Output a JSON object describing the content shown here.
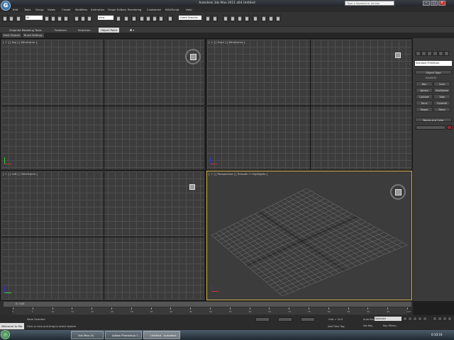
{
  "app": {
    "title": "Autodesk 3ds Max  2011 x64     Untitled",
    "logo_letter": "G",
    "search_placeholder": "Type a keyword or phrase"
  },
  "menu": [
    "Edit",
    "Tools",
    "Group",
    "Views",
    "Create",
    "Modifiers",
    "Animation",
    "Graph Editors",
    "Rendering",
    "Customize",
    "MAXScript",
    "Help"
  ],
  "toolbar": {
    "selection_filter": "All",
    "reference_coord": "View",
    "named_selection": "Create Selection Se"
  },
  "ribbon": {
    "tabs": [
      "Graphite Modeling Tools",
      "Freeform",
      "Selection",
      "Object Paint"
    ],
    "active_tab": 3,
    "subtabs": [
      "Paint Objects",
      "Brush Settings"
    ]
  },
  "viewports": {
    "top": "[ + ] [ Top ] [ Wireframe ]",
    "front": "[ + ] [ Front ] [ Wireframe ]",
    "left": "[ + ] [ Left ] [ Wireframe ]",
    "perspective": "[ + ] [ Perspective ] [ Smooth + Highlights ]"
  },
  "command_panel": {
    "dropdown": "Standard Primitives",
    "object_type_title": "Object Type",
    "autogrid": "AutoGrid",
    "objects": [
      "Box",
      "Cone",
      "Sphere",
      "GeoSphere",
      "Cylinder",
      "Tube",
      "Torus",
      "Pyramid",
      "Teapot",
      "Plane"
    ],
    "name_color_title": "Name and Color",
    "color": "#a0202a"
  },
  "timeline": {
    "slider": "0 / 100",
    "ticks": [
      "0",
      "5",
      "10",
      "15",
      "20",
      "25",
      "30",
      "35",
      "40",
      "45",
      "50",
      "55",
      "60",
      "65",
      "70",
      "75",
      "80",
      "85",
      "90",
      "95",
      "100"
    ]
  },
  "status": {
    "maxscript": "Welcome to Ma",
    "none_selected": "None Selected",
    "prompt": "Click or click-and-drag to select objects",
    "grid": "Grid = 10.0",
    "add_time_tag": "Add Time Tag",
    "auto_key": "Auto Key",
    "set_key": "Set Key",
    "selected": "Selected",
    "key_filters": "Key Filters..."
  },
  "taskbar": {
    "items": [
      "3ds Max (5)",
      "Adobe Photoshop C...",
      "Untitled - Autodesk..."
    ],
    "clock": "0:10:19"
  }
}
